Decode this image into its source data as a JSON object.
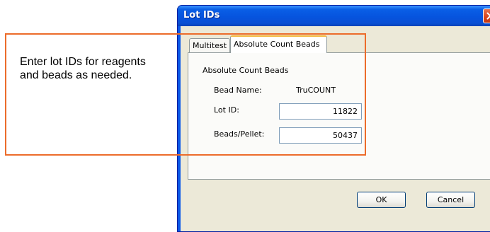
{
  "dialog": {
    "title": "Lot IDs",
    "close_icon": "close-icon",
    "colors": {
      "titlebar": "#0a5fe6",
      "close_button": "#d9441b",
      "client": "#ece9d8",
      "callout": "#ec6c2b"
    }
  },
  "tabs": [
    {
      "label": "Multitest",
      "selected": false
    },
    {
      "label": "Absolute Count Beads",
      "selected": true
    }
  ],
  "panel": {
    "group_label": "Absolute Count Beads",
    "bead_name_label": "Bead Name:",
    "bead_name_value": "TruCOUNT",
    "lot_id_label": "Lot ID:",
    "lot_id_value": "11822",
    "beads_per_pellet_label": "Beads/Pellet:",
    "beads_per_pellet_value": "50437"
  },
  "buttons": {
    "ok": "OK",
    "cancel": "Cancel"
  },
  "callout": {
    "text": "Enter lot IDs for reagents and beads as needed."
  }
}
